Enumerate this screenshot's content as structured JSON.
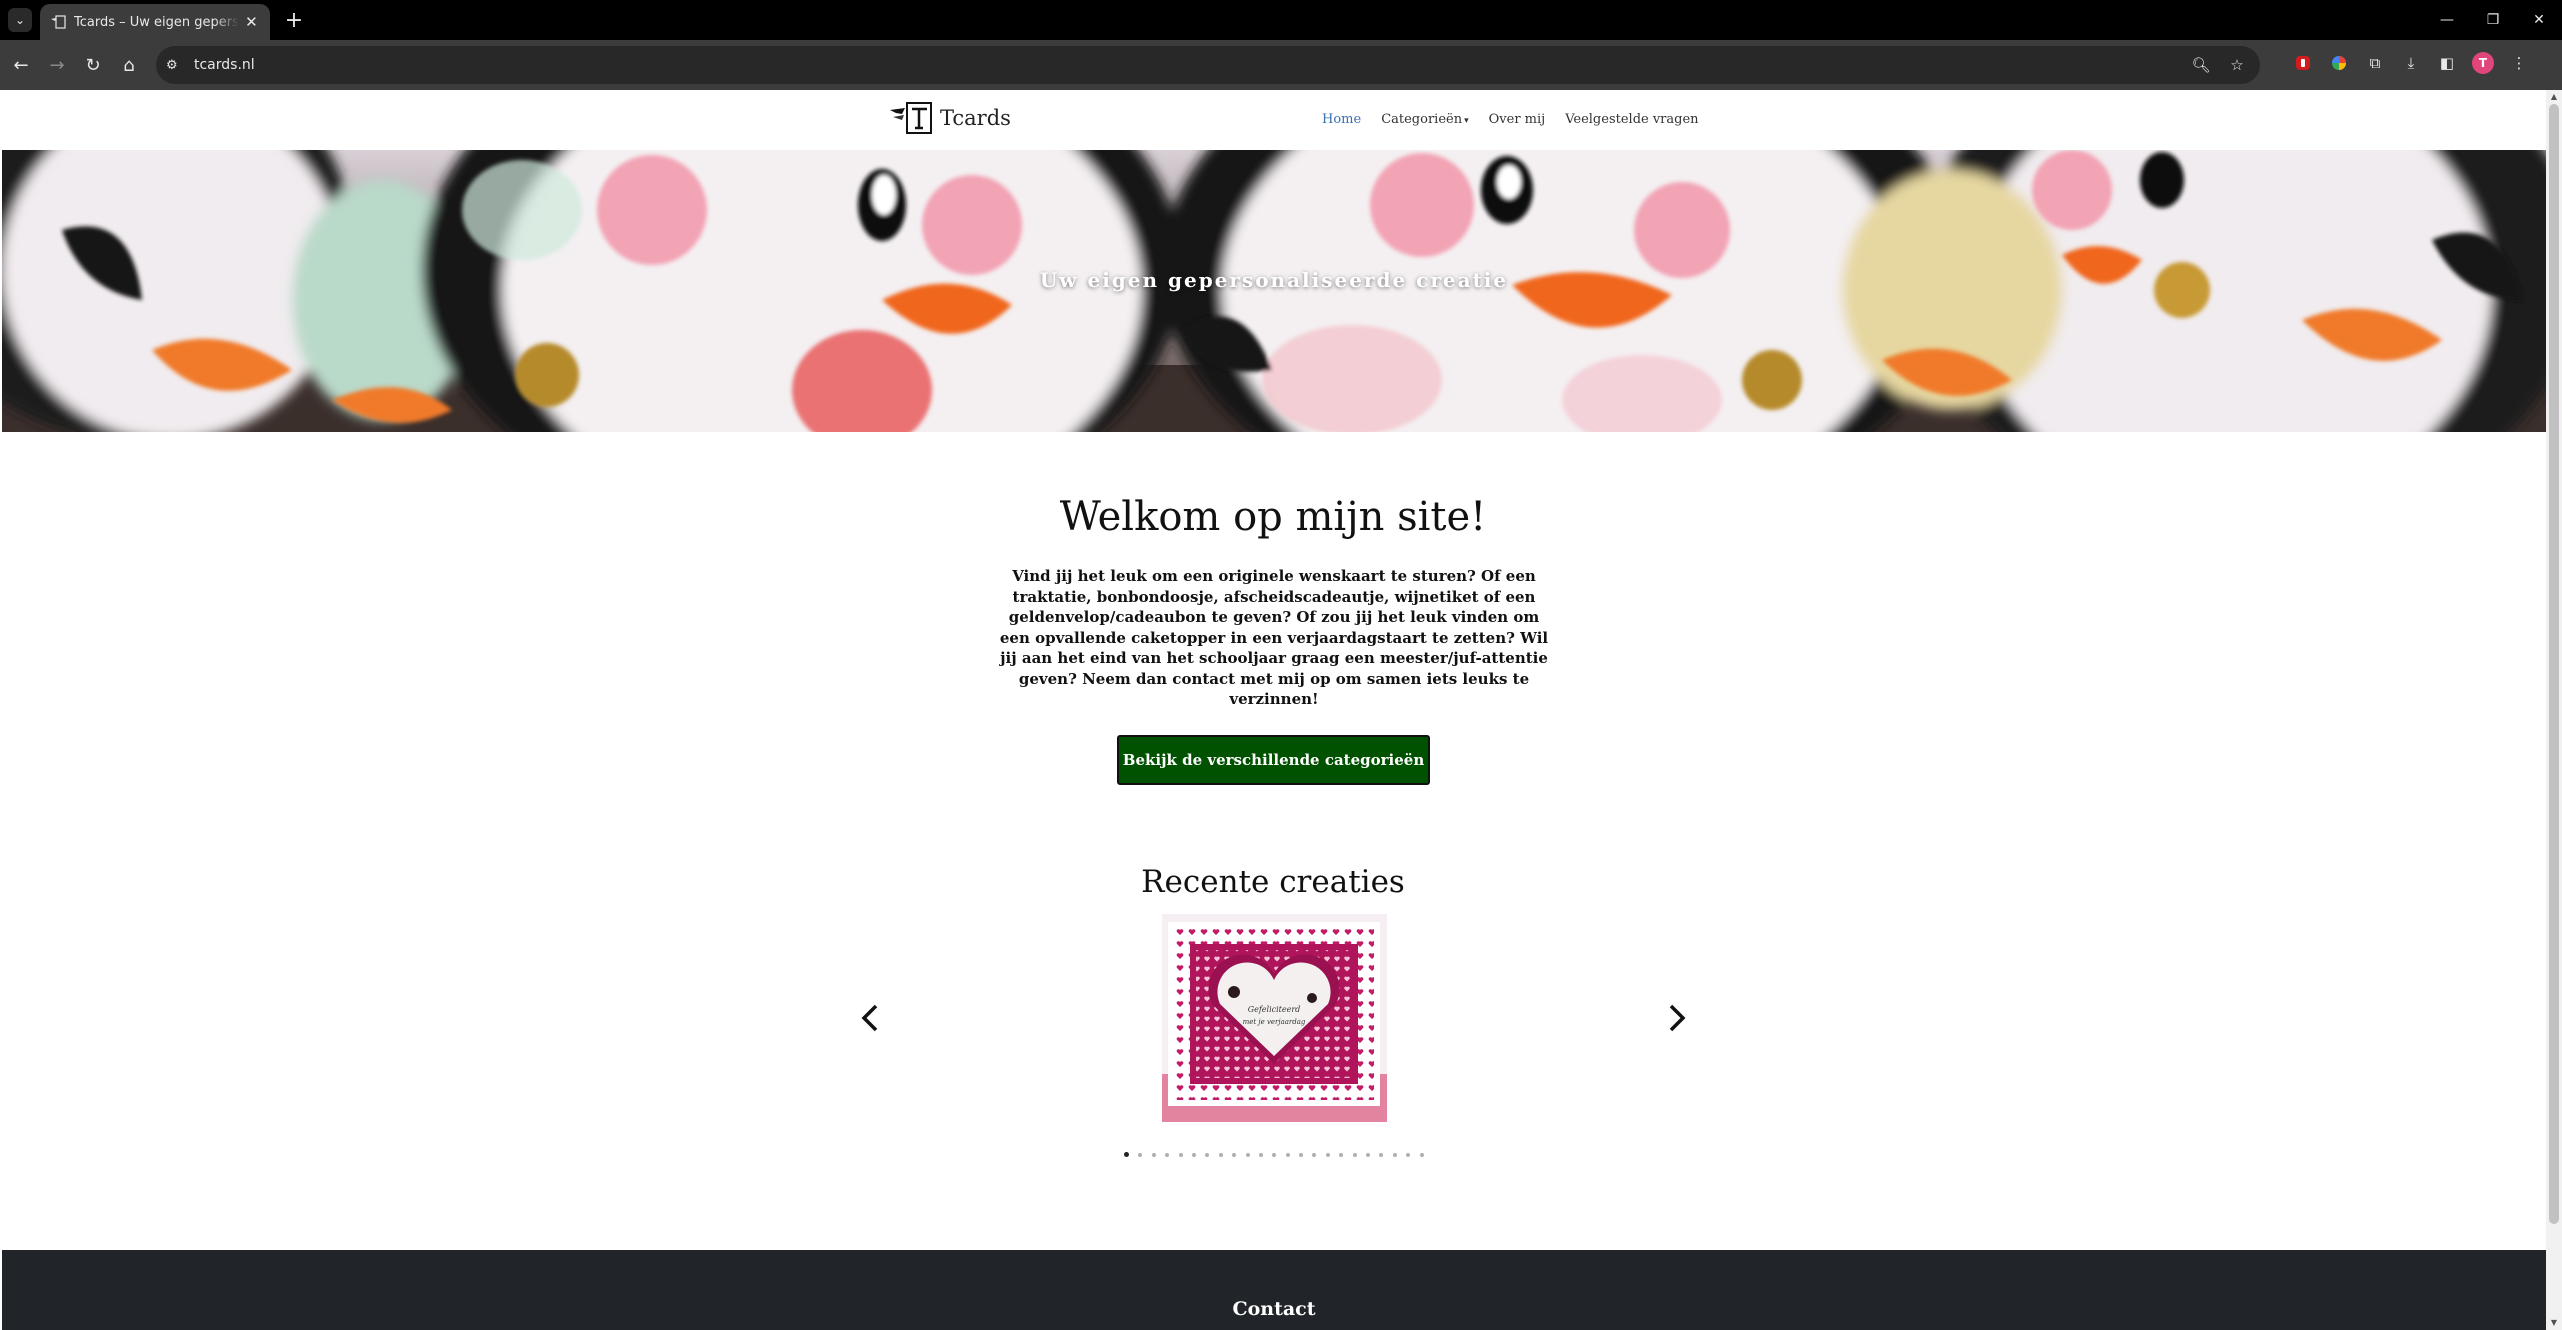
{
  "browser": {
    "tab_title": "Tcards – Uw eigen gepersonaliseerde creatie",
    "url": "tcards.nl",
    "profile_initial": "T"
  },
  "site": {
    "logo_name": "Tcards",
    "menu": [
      "Home",
      "Categorieën",
      "Over mij",
      "Veelgestelde vragen"
    ],
    "active_menu": "Home"
  },
  "hero": {
    "tagline": "Uw eigen gepersonaliseerde creatie"
  },
  "welcome": {
    "title": "Welkom op mijn site!",
    "text": "Vind jij het leuk om een originele wenskaart te sturen? Of een traktatie, bonbondoosje, afscheidscadeautje, wijnetiket of een geldenvelop/cadeaubon te geven? Of zou jij het leuk vinden om een opvallende caketopper in een verjaardagstaart te zetten? Wil jij aan het eind van het schooljaar graag een meester/juf-attentie geven? Neem dan contact met mij op om samen iets leuks te verzinnen!",
    "cta_label": "Bekijk de verschillende categorieën"
  },
  "recent": {
    "title": "Recente creaties",
    "slide_count": 23,
    "active_slide": 1,
    "card_text_line1": "Gefeliciteerd",
    "card_text_line2": "met je verjaardag"
  },
  "footer": {
    "title": "Contact"
  },
  "colors": {
    "cta_bg": "#005200",
    "menu_active": "#3a6fb0",
    "footer_bg": "#212529"
  }
}
